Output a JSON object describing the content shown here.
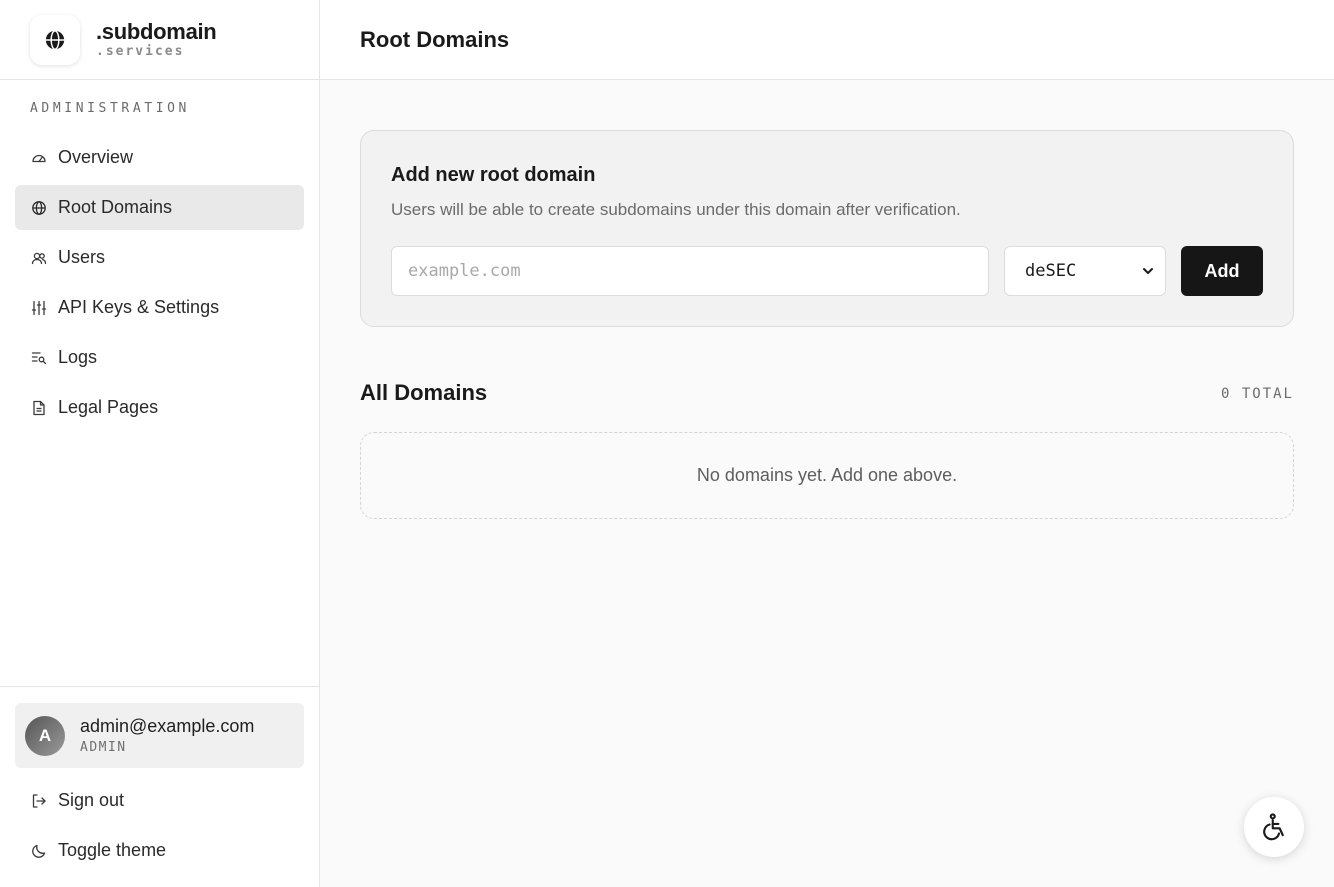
{
  "brand": {
    "name": ".subdomain",
    "sub": ".services",
    "logo_icon": "globe-icon"
  },
  "sidebar": {
    "section_label": "ADMINISTRATION",
    "items": [
      {
        "label": "Overview",
        "icon": "gauge-icon",
        "active": false
      },
      {
        "label": "Root Domains",
        "icon": "globe-icon",
        "active": true
      },
      {
        "label": "Users",
        "icon": "users-icon",
        "active": false
      },
      {
        "label": "API Keys & Settings",
        "icon": "sliders-icon",
        "active": false
      },
      {
        "label": "Logs",
        "icon": "logs-icon",
        "active": false
      },
      {
        "label": "Legal Pages",
        "icon": "document-icon",
        "active": false
      }
    ],
    "user": {
      "initial": "A",
      "email": "admin@example.com",
      "role": "ADMIN"
    },
    "sign_out": "Sign out",
    "toggle_theme": "Toggle theme"
  },
  "header": {
    "title": "Root Domains"
  },
  "add_card": {
    "title": "Add new root domain",
    "description": "Users will be able to create subdomains under this domain after verification.",
    "input_placeholder": "example.com",
    "input_value": "",
    "provider_selected": "deSEC",
    "add_label": "Add"
  },
  "domains": {
    "title": "All Domains",
    "total": "0 TOTAL",
    "empty_message": "No domains yet. Add one above."
  },
  "colors": {
    "accent": "#161616",
    "active_nav": "#e9e9e9"
  }
}
